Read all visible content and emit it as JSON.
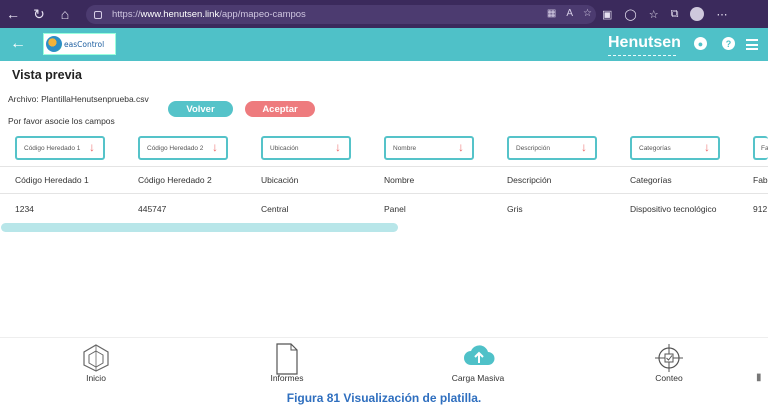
{
  "browser": {
    "url_prefix": "https://",
    "url_host": "www.henutsen.link",
    "url_path": "/app/mapeo-campos"
  },
  "header": {
    "logo_text": "easControl",
    "brand": "Henutsen"
  },
  "page": {
    "title": "Vista previa",
    "file_label": "Archivo: PlantillaHenutsenprueba.csv",
    "hint": "Por favor asocie los campos",
    "back_button": "Volver",
    "accept_button": "Aceptar"
  },
  "field_selects": [
    "Código Heredado 1",
    "Código Heredado 2",
    "Ubicación",
    "Nombre",
    "Descripción",
    "Categorías",
    "Fa"
  ],
  "table": {
    "headers": [
      "Código Heredado 1",
      "Código Heredado 2",
      "Ubicación",
      "Nombre",
      "Descripción",
      "Categorías",
      "Fab"
    ],
    "rows": [
      [
        "1234",
        "445747",
        "Central",
        "Panel",
        "Gris",
        "Dispositivo tecnológico",
        "912"
      ]
    ]
  },
  "bottom_nav": [
    {
      "label": "Inicio",
      "icon": "home-icon"
    },
    {
      "label": "Informes",
      "icon": "document-icon"
    },
    {
      "label": "Carga Masiva",
      "icon": "cloud-upload-icon"
    },
    {
      "label": "Conteo",
      "icon": "target-icon"
    }
  ],
  "caption": "Figura 81 Visualización de platilla.",
  "colors": {
    "accent": "#4fc1c8",
    "danger": "#ee7b7e",
    "browser": "#3b2a5c",
    "caption": "#2f6fbf"
  }
}
